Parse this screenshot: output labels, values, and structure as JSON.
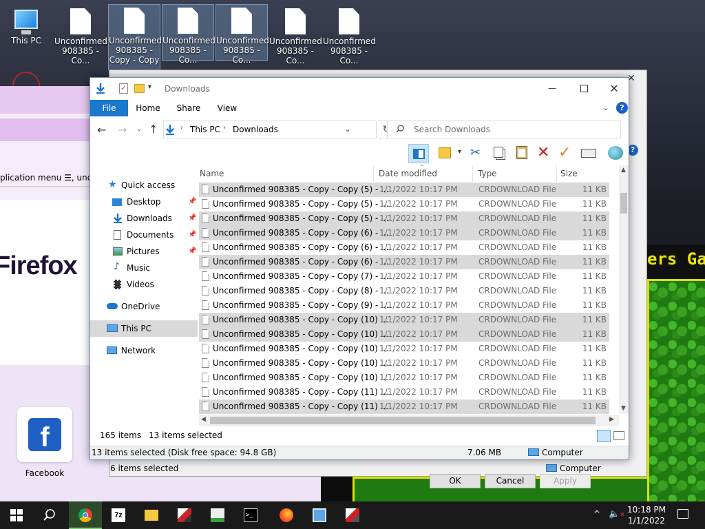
{
  "desktop": {
    "icons": [
      {
        "label": "This PC"
      },
      {
        "label": "Unconfirmed\n908385 - Co..."
      },
      {
        "label": "Unconfirmed\n908385 -\nCopy - Copy"
      },
      {
        "label": "Unconfirmed\n908385 - Co..."
      },
      {
        "label": "Unconfirmed\n908385 - Co..."
      },
      {
        "label": "Unconfirmed\n908385 - Co..."
      },
      {
        "label": "Unconfirmed\n908385 - Co..."
      }
    ],
    "firefox_fragment": {
      "menu_text": "plication menu ☰, unde",
      "brand": "Firefox"
    },
    "facebook": {
      "label": "Facebook"
    },
    "game_title_fragment": "ers Gam"
  },
  "back_window": {
    "status": "6 items selected",
    "computer": "Computer",
    "ok": "OK",
    "cancel": "Cancel",
    "apply": "Apply"
  },
  "explorer": {
    "title": "Downloads",
    "ribbon_tabs": [
      "File",
      "Home",
      "Share",
      "View"
    ],
    "breadcrumb": [
      "This PC",
      "Downloads"
    ],
    "search_placeholder": "Search Downloads",
    "nav": [
      {
        "label": "Quick access",
        "pinned": false
      },
      {
        "label": "Desktop",
        "pinned": true
      },
      {
        "label": "Downloads",
        "pinned": true
      },
      {
        "label": "Documents",
        "pinned": true
      },
      {
        "label": "Pictures",
        "pinned": true
      },
      {
        "label": "Music",
        "pinned": false
      },
      {
        "label": "Videos",
        "pinned": false
      },
      {
        "label": "OneDrive",
        "pinned": false
      },
      {
        "label": "This PC",
        "pinned": false,
        "selected": true
      },
      {
        "label": "Network",
        "pinned": false
      }
    ],
    "columns": [
      "Name",
      "Date modified",
      "Type",
      "Size"
    ],
    "files": [
      {
        "name": "Unconfirmed 908385 - Copy - Copy (5) - ...",
        "date": "1/1/2022 10:17 PM",
        "type": "CRDOWNLOAD File",
        "size": "11 KB",
        "selected": true
      },
      {
        "name": "Unconfirmed 908385 - Copy - Copy (5) - ...",
        "date": "1/1/2022 10:17 PM",
        "type": "CRDOWNLOAD File",
        "size": "11 KB",
        "selected": false
      },
      {
        "name": "Unconfirmed 908385 - Copy - Copy (5) - ...",
        "date": "1/1/2022 10:17 PM",
        "type": "CRDOWNLOAD File",
        "size": "11 KB",
        "selected": true
      },
      {
        "name": "Unconfirmed 908385 - Copy - Copy (6) - ...",
        "date": "1/1/2022 10:17 PM",
        "type": "CRDOWNLOAD File",
        "size": "11 KB",
        "selected": true
      },
      {
        "name": "Unconfirmed 908385 - Copy - Copy (6) - ...",
        "date": "1/1/2022 10:17 PM",
        "type": "CRDOWNLOAD File",
        "size": "11 KB",
        "selected": false
      },
      {
        "name": "Unconfirmed 908385 - Copy - Copy (6) - ...",
        "date": "1/1/2022 10:17 PM",
        "type": "CRDOWNLOAD File",
        "size": "11 KB",
        "selected": true
      },
      {
        "name": "Unconfirmed 908385 - Copy - Copy (7) - ...",
        "date": "1/1/2022 10:17 PM",
        "type": "CRDOWNLOAD File",
        "size": "11 KB",
        "selected": false
      },
      {
        "name": "Unconfirmed 908385 - Copy - Copy (8) - ...",
        "date": "1/1/2022 10:17 PM",
        "type": "CRDOWNLOAD File",
        "size": "11 KB",
        "selected": false
      },
      {
        "name": "Unconfirmed 908385 - Copy - Copy (9) - ...",
        "date": "1/1/2022 10:17 PM",
        "type": "CRDOWNLOAD File",
        "size": "11 KB",
        "selected": false
      },
      {
        "name": "Unconfirmed 908385 - Copy - Copy (10) ...",
        "date": "1/1/2022 10:17 PM",
        "type": "CRDOWNLOAD File",
        "size": "11 KB",
        "selected": true
      },
      {
        "name": "Unconfirmed 908385 - Copy - Copy (10) ...",
        "date": "1/1/2022 10:17 PM",
        "type": "CRDOWNLOAD File",
        "size": "11 KB",
        "selected": true
      },
      {
        "name": "Unconfirmed 908385 - Copy - Copy (10) ...",
        "date": "1/1/2022 10:17 PM",
        "type": "CRDOWNLOAD File",
        "size": "11 KB",
        "selected": false
      },
      {
        "name": "Unconfirmed 908385 - Copy - Copy (10) ...",
        "date": "1/1/2022 10:17 PM",
        "type": "CRDOWNLOAD File",
        "size": "11 KB",
        "selected": false
      },
      {
        "name": "Unconfirmed 908385 - Copy - Copy (10) ...",
        "date": "1/1/2022 10:17 PM",
        "type": "CRDOWNLOAD File",
        "size": "11 KB",
        "selected": false
      },
      {
        "name": "Unconfirmed 908385 - Copy - Copy (11) ...",
        "date": "1/1/2022 10:17 PM",
        "type": "CRDOWNLOAD File",
        "size": "11 KB",
        "selected": false
      },
      {
        "name": "Unconfirmed 908385 - Copy - Copy (11) ...",
        "date": "1/1/2022 10:17 PM",
        "type": "CRDOWNLOAD File",
        "size": "11 KB",
        "selected": true
      }
    ],
    "status": {
      "item_count": "165 items",
      "selected_count": "13 items selected",
      "detail": "13 items selected (Disk free space: 94.8 GB)",
      "size": "7.06 MB",
      "location": "Computer"
    }
  },
  "taskbar": {
    "apps": [
      "start",
      "search",
      "chrome",
      "7zip",
      "file-explorer",
      "app-red",
      "app-chart",
      "terminal",
      "firefox",
      "app-blue",
      "app-gray"
    ],
    "time": "10:18 PM",
    "date": "1/1/2022"
  }
}
